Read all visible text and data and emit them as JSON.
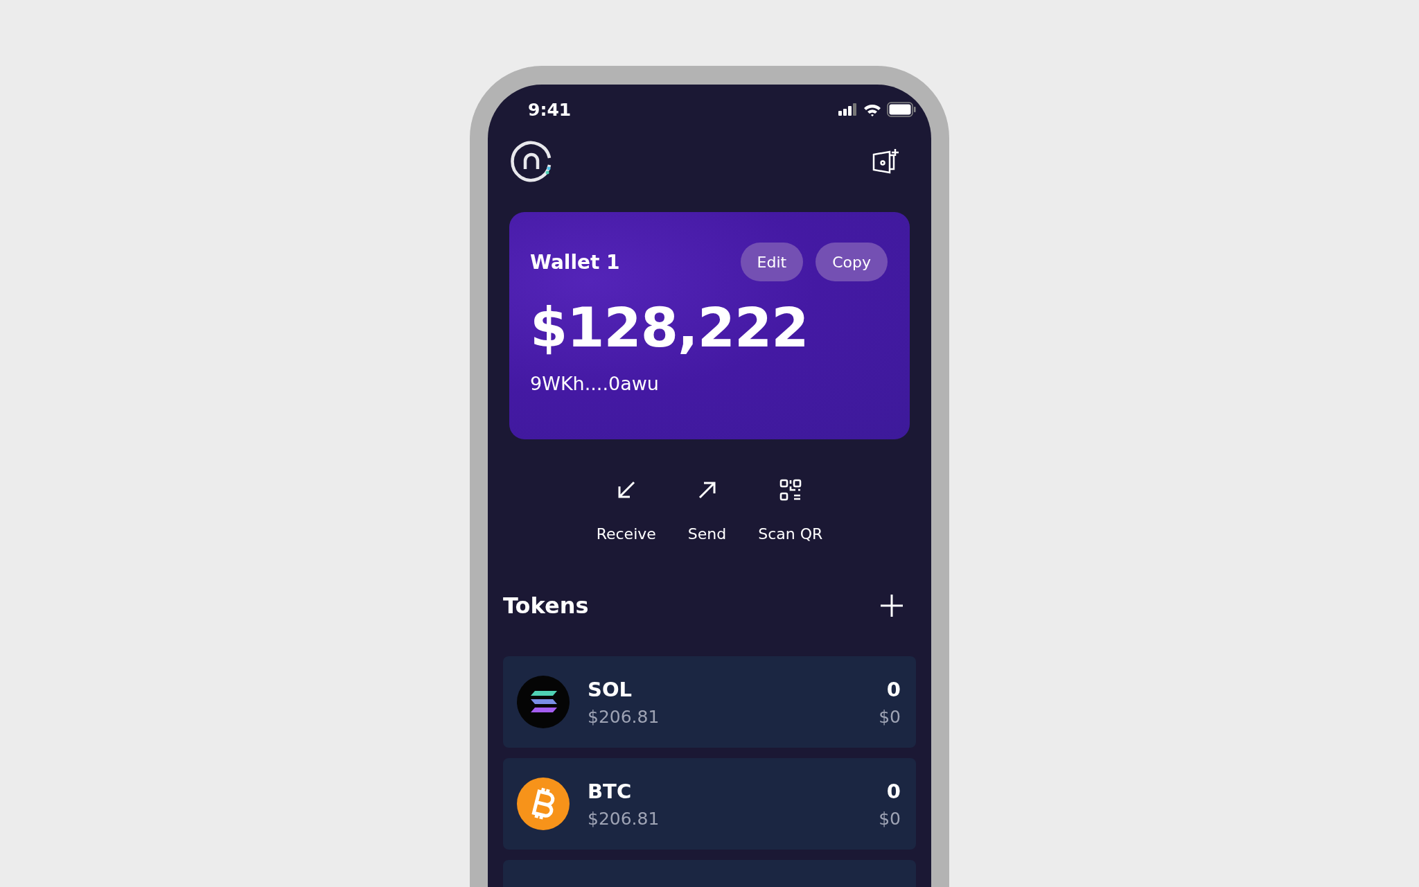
{
  "status_bar": {
    "time": "9:41"
  },
  "wallet_card": {
    "name": "Wallet 1",
    "buttons": [
      "Edit",
      "Copy"
    ],
    "balance": "$128,222",
    "address": "9WKh....0awu"
  },
  "actions": [
    {
      "kind": "receive",
      "label": "Receive"
    },
    {
      "kind": "send",
      "label": "Send"
    },
    {
      "kind": "scan",
      "label": "Scan QR"
    }
  ],
  "tokens": {
    "title": "Tokens",
    "items": [
      {
        "kind": "sol",
        "symbol": "SOL",
        "price": "$206.81",
        "amount": "0",
        "value": "$0"
      },
      {
        "kind": "btc",
        "symbol": "BTC",
        "price": "$206.81",
        "amount": "0",
        "value": "$0"
      }
    ]
  }
}
